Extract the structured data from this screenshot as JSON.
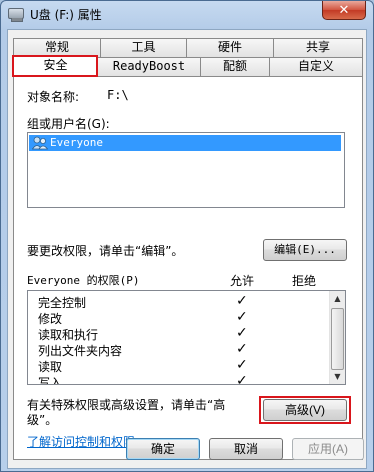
{
  "window": {
    "title": "U盘 (F:) 属性",
    "close_glyph": "✕"
  },
  "tabs_row1": [
    {
      "label": "常规"
    },
    {
      "label": "工具"
    },
    {
      "label": "硬件"
    },
    {
      "label": "共享"
    }
  ],
  "tabs_row2": [
    {
      "label": "安全",
      "selected": true
    },
    {
      "label": "ReadyBoost"
    },
    {
      "label": "配额"
    },
    {
      "label": "自定义"
    }
  ],
  "security": {
    "object_label": "对象名称:",
    "object_value": "F:\\",
    "group_label": "组或用户名(G):",
    "users": [
      {
        "name": "Everyone",
        "icon": "users-icon",
        "selected": true
      }
    ],
    "change_hint": "要更改权限，请单击“编辑”。",
    "edit_button": "编辑(E)...",
    "perm_header": "Everyone 的权限(P)",
    "allow_header": "允许",
    "deny_header": "拒绝",
    "permissions": [
      {
        "name": "完全控制",
        "allow": "✓",
        "deny": ""
      },
      {
        "name": "修改",
        "allow": "✓",
        "deny": ""
      },
      {
        "name": "读取和执行",
        "allow": "✓",
        "deny": ""
      },
      {
        "name": "列出文件夹内容",
        "allow": "✓",
        "deny": ""
      },
      {
        "name": "读取",
        "allow": "✓",
        "deny": ""
      },
      {
        "name": "写入",
        "allow": "✓",
        "deny": ""
      }
    ],
    "special_hint_line1": "有关特殊权限或高级设置，请单击“高",
    "special_hint_line2": "级”。",
    "advanced_button": "高级(V)",
    "learn_link": "了解访问控制和权限"
  },
  "buttons": {
    "ok": "确定",
    "cancel": "取消",
    "apply": "应用(A)"
  },
  "colors": {
    "highlight_box": "#d9161c",
    "selection": "#3399ff",
    "link": "#0066cc"
  }
}
